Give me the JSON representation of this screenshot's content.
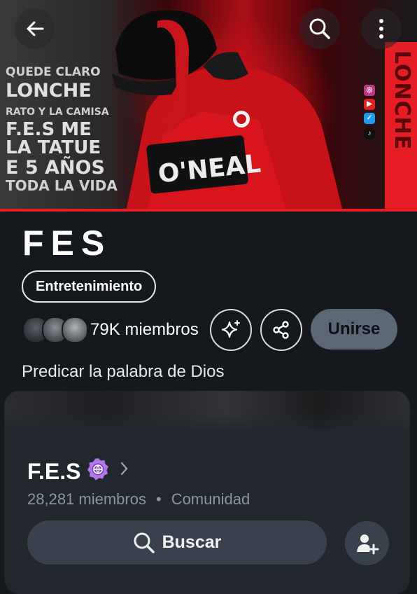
{
  "banner": {
    "slogan": [
      "QUEDE CLARO",
      "LONCHE",
      "RATO Y LA CAMISA",
      "F.E.S ME LA TATUE",
      "E 5 AÑOS",
      "TODA LA VIDA"
    ],
    "side_text": "LONCHE",
    "shirt_text": "O'NEAL",
    "socials": [
      "instagram-icon",
      "youtube-icon",
      "twitter-icon",
      "tiktok-icon"
    ]
  },
  "top_bar": {
    "back_icon": "back-arrow-icon",
    "search_icon": "search-icon",
    "more_icon": "more-vertical-icon"
  },
  "community": {
    "name": "FES",
    "category": "Entretenimiento",
    "members": "79K miembros",
    "join_label": "Unirse",
    "description": "Predicar la palabra de Dios"
  },
  "sub_community": {
    "name": "F.E.S",
    "members": "28,281 miembros",
    "separator": "•",
    "type": "Comunidad",
    "search_label": "Buscar"
  },
  "colors": {
    "background": "#15191e",
    "accent_red": "#e51d24",
    "join_bg": "#5b6775",
    "card_bg": "#22272e",
    "badge": "#b276e8"
  }
}
